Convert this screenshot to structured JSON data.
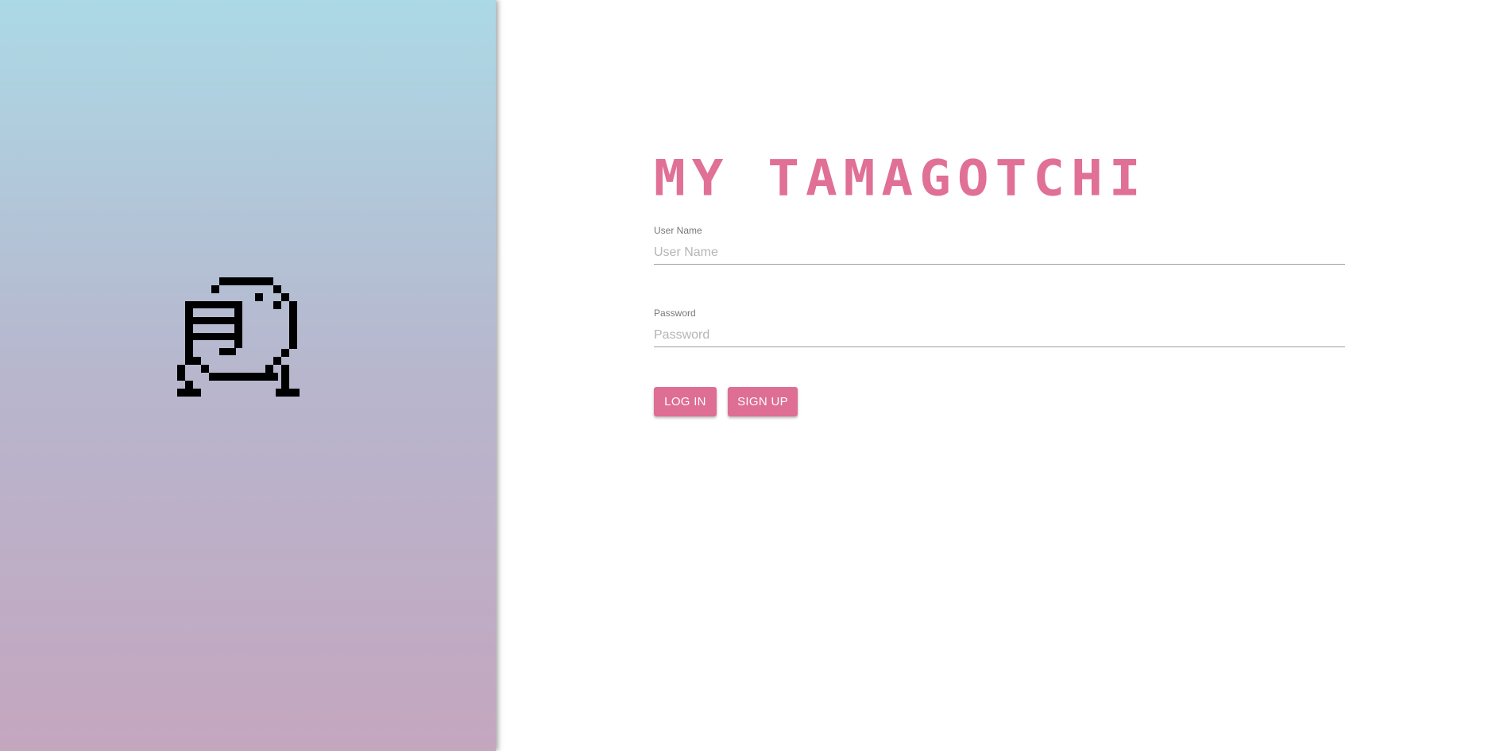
{
  "app": {
    "title": "MY TAMAGOTCHI",
    "accent_color": "#de6e93"
  },
  "mascot": {
    "icon": "tamagotchi-pixel-icon"
  },
  "login_form": {
    "username": {
      "label": "User Name",
      "placeholder": "User Name",
      "value": ""
    },
    "password": {
      "label": "Password",
      "placeholder": "Password",
      "value": ""
    },
    "login_button": "LOG IN",
    "signup_button": "SIGN UP"
  }
}
